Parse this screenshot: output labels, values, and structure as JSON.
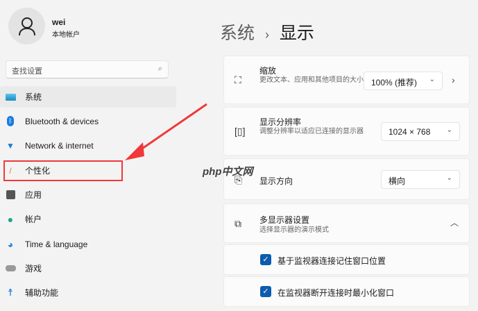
{
  "user": {
    "name": "wei",
    "type": "本地帐户"
  },
  "search": {
    "placeholder": "查找设置"
  },
  "nav": [
    {
      "label": "系统",
      "icon": "monitor-icon"
    },
    {
      "label": "Bluetooth & devices",
      "icon": "bluetooth-icon"
    },
    {
      "label": "Network & internet",
      "icon": "wifi-icon"
    },
    {
      "label": "个性化",
      "icon": "brush-icon"
    },
    {
      "label": "应用",
      "icon": "apps-icon"
    },
    {
      "label": "帐户",
      "icon": "person-icon"
    },
    {
      "label": "Time & language",
      "icon": "globe-clock-icon"
    },
    {
      "label": "游戏",
      "icon": "gamepad-icon"
    },
    {
      "label": "辅助功能",
      "icon": "accessibility-icon"
    }
  ],
  "breadcrumb": {
    "parent": "系统",
    "sep": "›",
    "current": "显示"
  },
  "settings": {
    "scale": {
      "title": "缩放",
      "desc": "更改文本、应用和其他项目的大小",
      "value": "100% (推荐)"
    },
    "resolution": {
      "title": "显示分辨率",
      "desc": "调整分辨率以适应已连接的显示器",
      "value": "1024 × 768"
    },
    "orientation": {
      "title": "显示方向",
      "value": "横向"
    },
    "multi": {
      "title": "多显示器设置",
      "desc": "选择显示器的演示模式",
      "options": [
        "基于监视器连接记住窗口位置",
        "在监视器断开连接时最小化窗口"
      ]
    }
  },
  "watermark": "php中文网",
  "colors": {
    "accent": "#0b5cad",
    "highlight": "#f0383a"
  }
}
